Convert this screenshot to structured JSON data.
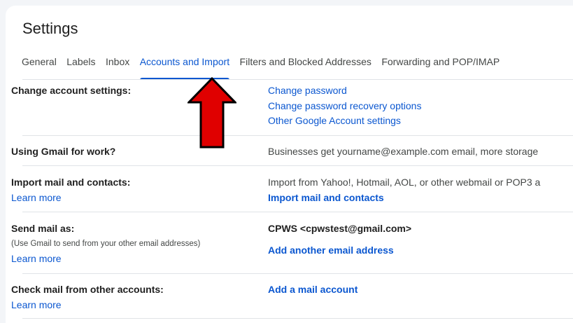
{
  "page": {
    "title": "Settings"
  },
  "tabs": [
    {
      "label": "General"
    },
    {
      "label": "Labels"
    },
    {
      "label": "Inbox"
    },
    {
      "label": "Accounts and Import"
    },
    {
      "label": "Filters and Blocked Addresses"
    },
    {
      "label": "Forwarding and POP/IMAP"
    }
  ],
  "active_tab": "Accounts and Import",
  "sections": {
    "change_account": {
      "label": "Change account settings:",
      "links": [
        "Change password",
        "Change password recovery options",
        "Other Google Account settings"
      ]
    },
    "gmail_work": {
      "label": "Using Gmail for work?",
      "text": "Businesses get yourname@example.com email, more storage"
    },
    "import": {
      "label": "Import mail and contacts:",
      "learn_more": "Learn more",
      "text": "Import from Yahoo!, Hotmail, AOL, or other webmail or POP3 a",
      "action": "Import mail and contacts"
    },
    "send_as": {
      "label": "Send mail as:",
      "sublabel": "(Use Gmail to send from your other email addresses)",
      "learn_more": "Learn more",
      "address": "CPWS <cpwstest@gmail.com>",
      "action": "Add another email address"
    },
    "check_mail": {
      "label": "Check mail from other accounts:",
      "learn_more": "Learn more",
      "action": "Add a mail account"
    }
  },
  "annotation": {
    "arrow_color": "#e00000",
    "arrow_outline": "#000000",
    "icon": "up-arrow-annotation-icon"
  },
  "colors": {
    "accent": "#0b57d0",
    "text": "#1f1f1f",
    "muted": "#444746",
    "divider": "#e0e3e7"
  }
}
